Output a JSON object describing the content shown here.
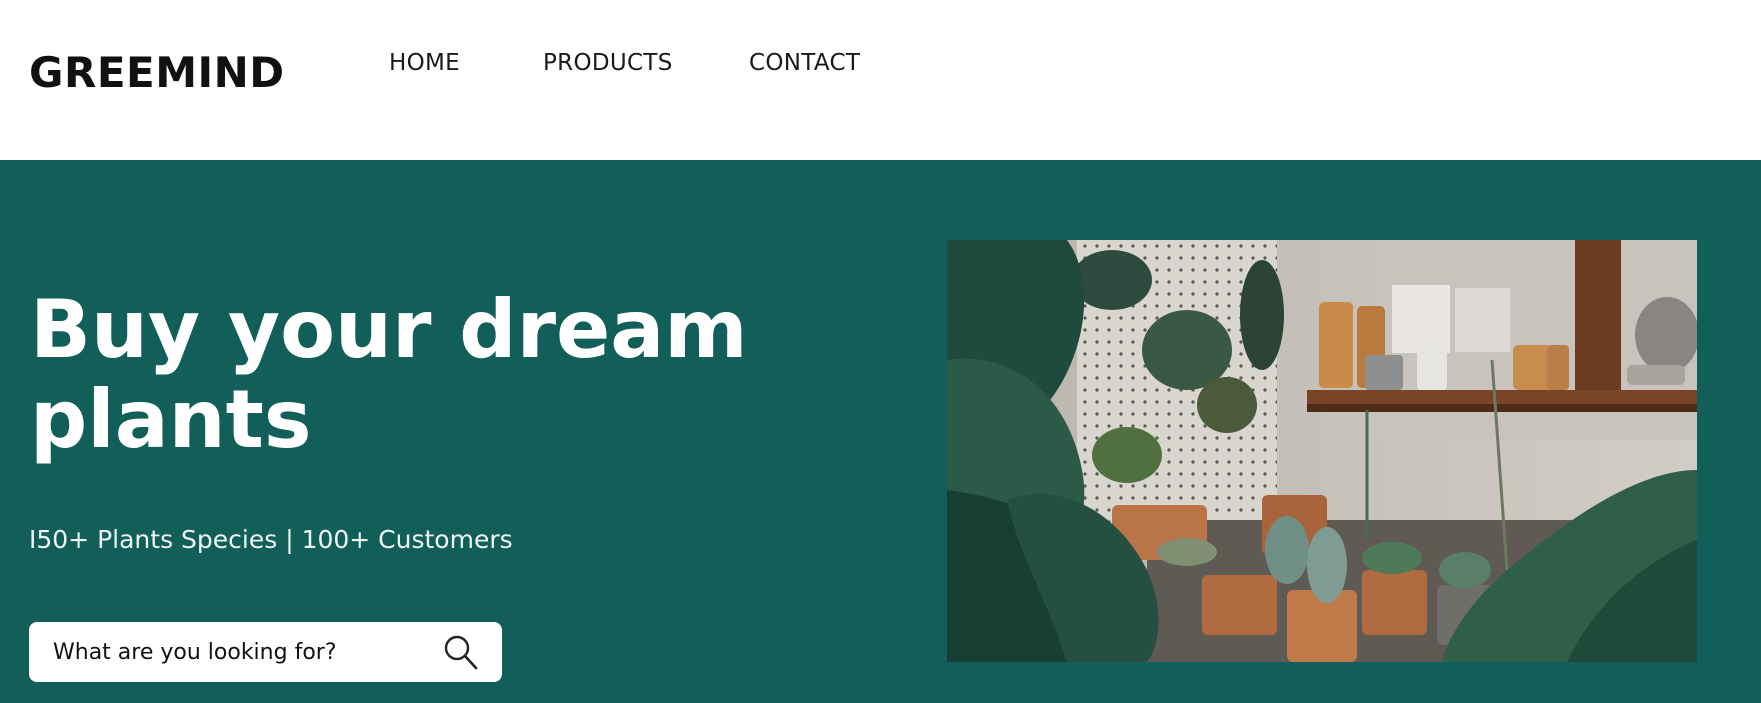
{
  "header": {
    "logo": "GREEMIND",
    "nav": [
      {
        "label": "HOME"
      },
      {
        "label": "PRODUCTS"
      },
      {
        "label": "CONTACT"
      }
    ]
  },
  "hero": {
    "headline": "Buy your dream plants",
    "stats": "I50+ Plants Species | 100+ Customers",
    "search": {
      "placeholder": "What are you looking for?",
      "icon": "search-icon"
    },
    "image": {
      "subject": "potted plants on shelves and pegboard wall",
      "icon": "plants-photo"
    }
  },
  "colors": {
    "hero_background": "#125e59",
    "header_background": "#ffffff",
    "text_light": "#ffffff"
  }
}
